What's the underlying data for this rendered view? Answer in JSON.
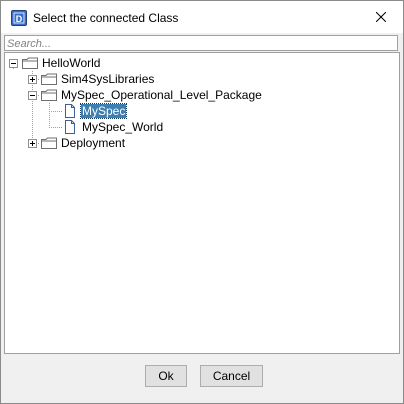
{
  "window": {
    "title": "Select the connected Class",
    "app_icon_letter": "D"
  },
  "search": {
    "placeholder": "Search...",
    "value": ""
  },
  "tree": {
    "root": {
      "label": "HelloWorld",
      "expanded": true
    },
    "items": [
      {
        "label": "Sim4SysLibraries",
        "type": "folder",
        "expanded": false
      },
      {
        "label": "MySpec_Operational_Level_Package",
        "type": "folder",
        "expanded": true
      },
      {
        "label": "MySpec",
        "type": "class",
        "selected": true
      },
      {
        "label": "MySpec_World",
        "type": "class",
        "selected": false
      },
      {
        "label": "Deployment",
        "type": "folder",
        "expanded": false
      }
    ]
  },
  "buttons": {
    "ok": "Ok",
    "cancel": "Cancel"
  },
  "colors": {
    "selection": "#3c7fb1",
    "window_bg": "#f0f0f0"
  }
}
